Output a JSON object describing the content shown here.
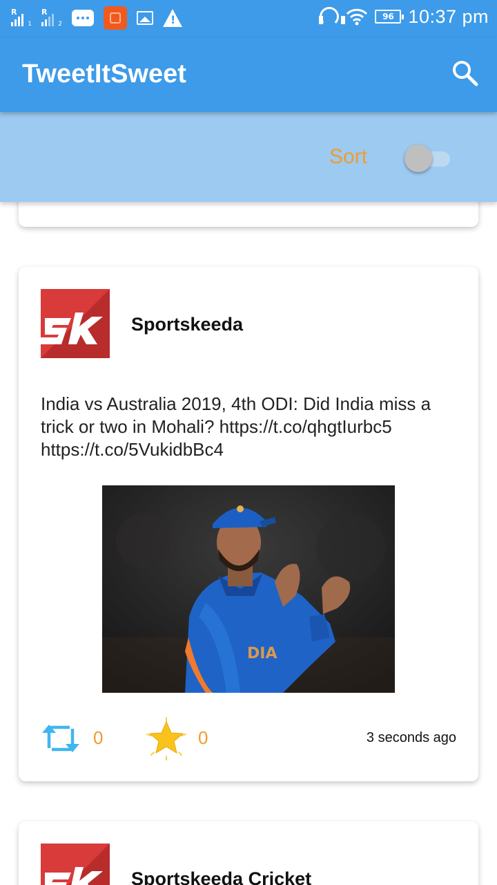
{
  "status_bar": {
    "sim1": "R",
    "sim1_slot": "1",
    "sim2": "R",
    "sim2_slot": "2",
    "battery": "96",
    "time": "10:37 pm",
    "icons": [
      "signal-icon",
      "signal-icon",
      "chat-icon",
      "app-notification-icon",
      "image-icon",
      "warning-icon",
      "headset-icon",
      "wifi-icon",
      "battery-icon"
    ]
  },
  "app_bar": {
    "title": "TweetItSweet",
    "search_icon": "search-icon",
    "color": "#3d9be9"
  },
  "sort_bar": {
    "label": "Sort",
    "toggle_on": false,
    "label_color": "#f29b2f",
    "background": "#9ccaf1"
  },
  "feed": {
    "tweets": [
      {
        "author": "Sportskeeda",
        "avatar": "sportskeeda-logo",
        "text": "India vs Australia 2019, 4th ODI: Did India miss a trick or two in Mohali? https://t.co/qhgtIurbc5 https://t.co/5VukidbBc4",
        "media": "cricket-player-photo",
        "retweets": "0",
        "favorites": "0",
        "time": "3 seconds ago"
      },
      {
        "author": "Sportskeeda Cricket",
        "avatar": "sportskeeda-logo"
      }
    ]
  }
}
